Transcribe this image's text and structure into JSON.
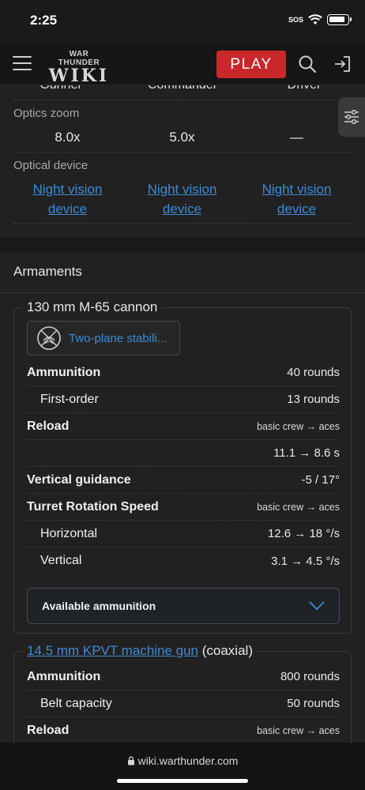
{
  "status": {
    "time": "2:25",
    "sos": "SOS"
  },
  "header": {
    "logo_top": "WAR THUNDER",
    "logo_main": "WIKI",
    "play_label": "PLAY"
  },
  "crew": {
    "gunner": "Gunner",
    "commander": "Commander",
    "driver": "Driver"
  },
  "optics_zoom": {
    "label": "Optics zoom",
    "gunner": "8.0x",
    "commander": "5.0x",
    "driver": "—"
  },
  "optical_device": {
    "label": "Optical device",
    "gunner_line1": "Night vision",
    "gunner_line2": "device",
    "commander_line1": "Night vision",
    "commander_line2": "device",
    "driver_line1": "Night vision",
    "driver_line2": "device"
  },
  "armaments": {
    "title": "Armaments",
    "cannon": {
      "title": "130 mm M-65 cannon",
      "stabilizer": "Two-plane stabili...",
      "rows": [
        {
          "label": "Ammunition",
          "value": "40 rounds"
        },
        {
          "label": "First-order",
          "value": "13 rounds"
        },
        {
          "label": "Reload",
          "value": "basic crew → aces"
        },
        {
          "label": "",
          "value": "11.1 → 8.6 s"
        },
        {
          "label": "Vertical guidance",
          "value": "-5 / 17°"
        },
        {
          "label": "Turret Rotation Speed",
          "value": "basic crew → aces"
        },
        {
          "label": "Horizontal",
          "value": "12.6 → 18 °/s"
        },
        {
          "label": "Vertical",
          "value": "3.1 → 4.5 °/s"
        }
      ],
      "available_ammo": "Available ammunition"
    },
    "mg": {
      "title_link": "14.5 mm KPVT machine gun",
      "title_suffix": " (coaxial)",
      "rows": [
        {
          "label": "Ammunition",
          "value": "800 rounds"
        },
        {
          "label": "Belt capacity",
          "value": "50 rounds"
        },
        {
          "label": "Reload",
          "value": "basic crew → aces"
        }
      ]
    }
  },
  "browser": {
    "url": "wiki.warthunder.com"
  },
  "colors": {
    "accent_link": "#3d8bd6",
    "play_red": "#c8282c",
    "background": "#1a1a1a",
    "card": "#212121"
  }
}
